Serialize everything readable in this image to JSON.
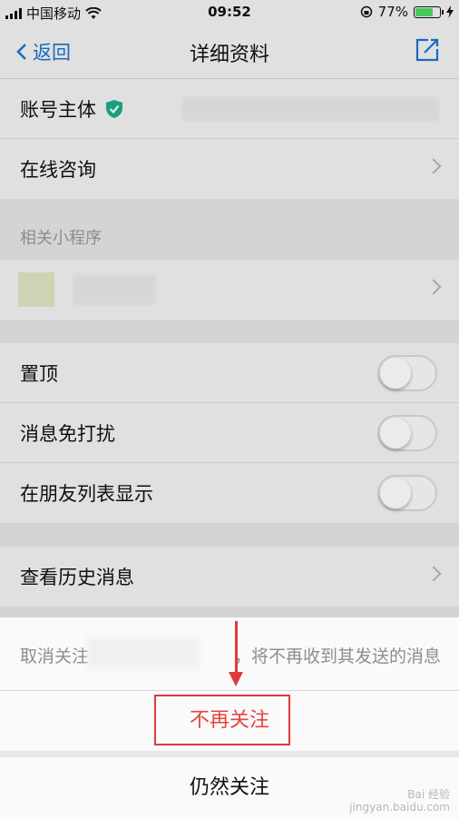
{
  "status_bar": {
    "carrier": "中国移动",
    "time": "09:52",
    "battery": "77%",
    "battery_level": 0.77
  },
  "nav": {
    "back_label": "返回",
    "title": "详细资料",
    "edit_icon": "edit-icon"
  },
  "account": {
    "label": "账号主体",
    "verified_icon": "verified-shield-icon"
  },
  "consult": {
    "label": "在线咨询"
  },
  "mini_programs": {
    "section_label": "相关小程序"
  },
  "settings": [
    {
      "label": "置顶",
      "on": false
    },
    {
      "label": "消息免打扰",
      "on": false
    },
    {
      "label": "在朋友列表显示",
      "on": false
    }
  ],
  "history": {
    "label": "查看历史消息"
  },
  "sheet": {
    "message_prefix": "取消关注",
    "message_suffix": "，将不再收到其发送的消息",
    "unfollow_label": "不再关注",
    "keep_label": "仍然关注"
  },
  "watermark": {
    "line1": "Bai 经验",
    "line2": "jingyan.baidu.com"
  },
  "colors": {
    "accent": "#1a74d2",
    "destructive": "#e64340",
    "annotation": "#e03a3a",
    "verified": "#1aad8b"
  }
}
